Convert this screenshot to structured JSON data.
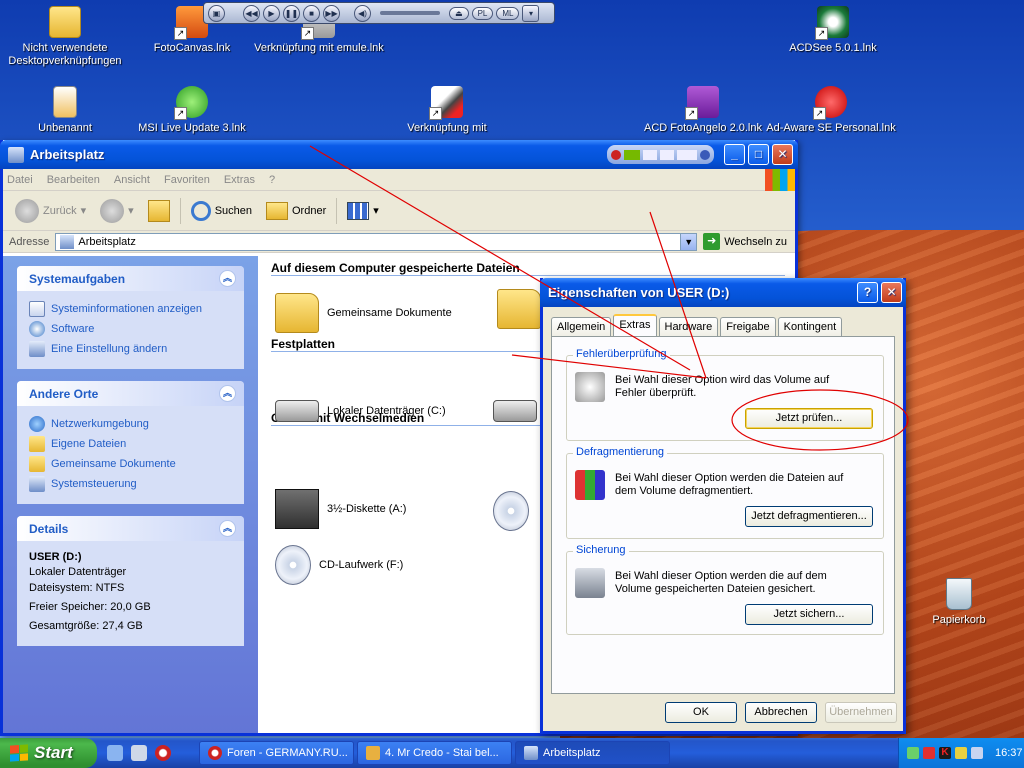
{
  "desktop": {
    "icons": [
      {
        "label": "Nicht verwendete Desktopverknüpfungen",
        "icon": "folder-icon"
      },
      {
        "label": "FotoCanvas.lnk",
        "icon": "fotocanvas-icon"
      },
      {
        "label": "Verknüpfung mit emule.lnk",
        "icon": "emule-icon"
      },
      {
        "label": "ACDSee 5.0.1.lnk",
        "icon": "acdsee-icon"
      },
      {
        "label": "Unbenannt",
        "icon": "image-file-icon"
      },
      {
        "label": "MSI Live Update 3.lnk",
        "icon": "msi-live-icon"
      },
      {
        "label": "Verknüpfung mit",
        "icon": "shortcut-icon"
      },
      {
        "label": "ACD FotoAngelo 2.0.lnk",
        "icon": "fotoangelo-icon"
      },
      {
        "label": "Ad-Aware SE Personal.lnk",
        "icon": "adaware-icon"
      },
      {
        "label": "Papierkorb",
        "icon": "recycle-bin-icon"
      }
    ],
    "media_bar": {
      "buttons": [
        "PL",
        "ML"
      ]
    }
  },
  "explorer": {
    "title": "Arbeitsplatz",
    "menu": [
      "Datei",
      "Bearbeiten",
      "Ansicht",
      "Favoriten",
      "Extras",
      "?"
    ],
    "toolbar": {
      "back": "Zurück",
      "search": "Suchen",
      "folders": "Ordner"
    },
    "address_label": "Adresse",
    "address_value": "Arbeitsplatz",
    "go_label": "Wechseln zu",
    "panels": {
      "system": {
        "title": "Systemaufgaben",
        "links": [
          "Systeminformationen anzeigen",
          "Software",
          "Eine Einstellung ändern"
        ]
      },
      "places": {
        "title": "Andere Orte",
        "links": [
          "Netzwerkumgebung",
          "Eigene Dateien",
          "Gemeinsame Dokumente",
          "Systemsteuerung"
        ]
      },
      "details": {
        "title": "Details",
        "name": "USER (D:)",
        "type": "Lokaler Datenträger",
        "fs": "Dateisystem: NTFS",
        "free": "Freier Speicher: 20,0 GB",
        "total": "Gesamtgröße: 27,4 GB"
      }
    },
    "sections": {
      "files": "Auf diesem Computer gespeicherte Dateien",
      "disks": "Festplatten",
      "removable": "Geräte mit Wechselmedien"
    },
    "items": {
      "shared_docs": "Gemeinsame Dokumente",
      "local_c": "Lokaler Datenträger (C:)",
      "floppy": "3½-Diskette (A:)",
      "cd_f": "CD-Laufwerk (F:)"
    }
  },
  "dialog": {
    "title": "Eigenschaften von USER (D:)",
    "tabs": [
      "Allgemein",
      "Extras",
      "Hardware",
      "Freigabe",
      "Kontingent"
    ],
    "active_tab": "Extras",
    "groups": {
      "check": {
        "legend": "Fehlerüberprüfung",
        "text": "Bei Wahl dieser Option wird das Volume auf Fehler überprüft.",
        "button": "Jetzt prüfen..."
      },
      "defrag": {
        "legend": "Defragmentierung",
        "text": "Bei Wahl dieser Option werden die Dateien auf dem Volume defragmentiert.",
        "button": "Jetzt defragmentieren..."
      },
      "backup": {
        "legend": "Sicherung",
        "text": "Bei Wahl dieser Option werden die auf dem Volume gespeicherten Dateien gesichert.",
        "button": "Jetzt sichern..."
      }
    },
    "ok": "OK",
    "cancel": "Abbrechen",
    "apply": "Übernehmen"
  },
  "taskbar": {
    "start": "Start",
    "tasks": [
      "Foren - GERMANY.RU...",
      "4. Mr Credo - Stai bel...",
      "Arbeitsplatz"
    ],
    "clock": "16:37"
  },
  "colors": {
    "xp_blue": "#0453d8",
    "start_green": "#3c9e3c",
    "annotation_red": "#e00000",
    "link_blue": "#215dc6"
  }
}
